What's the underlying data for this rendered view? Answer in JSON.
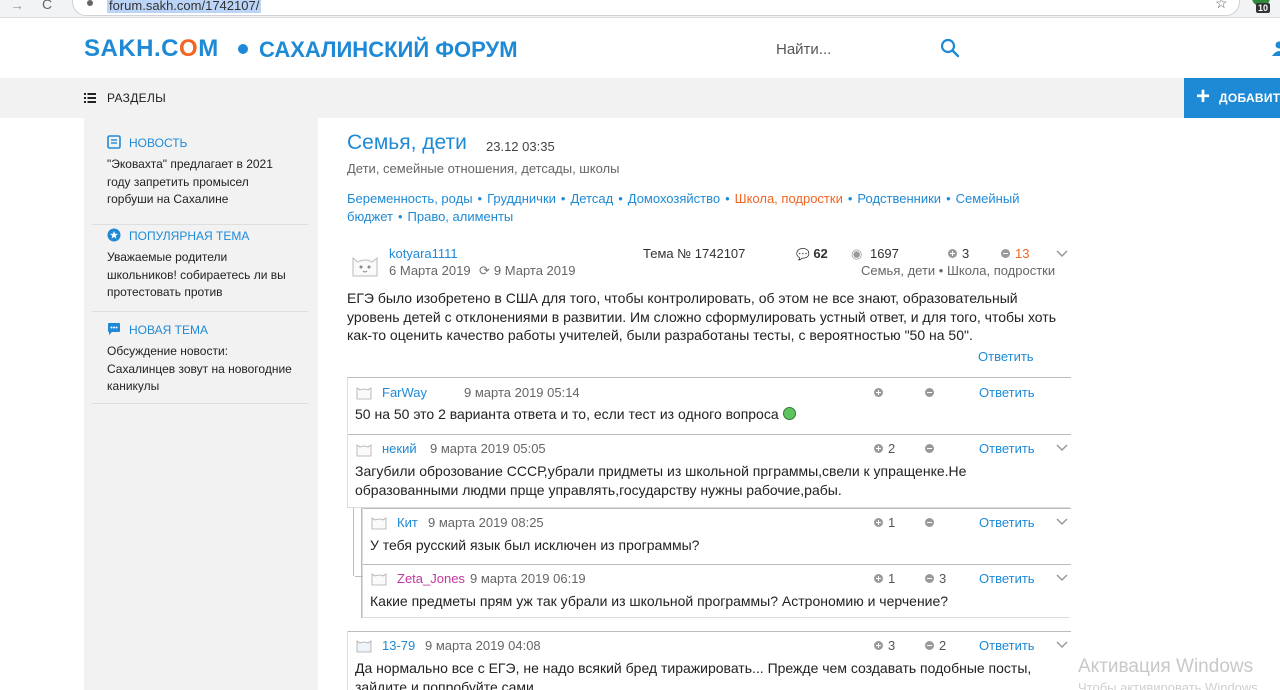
{
  "browser": {
    "url": "forum.sakh.com/1742107/",
    "extension_badge": "10"
  },
  "header": {
    "logo_prefix": "SAKH.C",
    "logo_o": "O",
    "logo_suffix": "M",
    "site_title": "САХАЛИНСКИЙ ФОРУМ",
    "search_placeholder": "Найти..."
  },
  "subbar": {
    "sections_label": "РАЗДЕЛЫ",
    "add_label": "ДОБАВИТЬ"
  },
  "sidebar": {
    "news": {
      "title": "НОВОСТЬ",
      "text": "\"Эковахта\" предлагает в 2021 году запретить промысел горбуши на Сахалине"
    },
    "popular": {
      "title": "ПОПУЛЯРНАЯ ТЕМА",
      "text": "Уважаемые родители школьников! собираетесь ли вы протестовать против"
    },
    "new_topic": {
      "title": "НОВАЯ ТЕМА",
      "text": "Обсуждение новости: Сахалинцев зовут на новогодние каникулы"
    }
  },
  "forum": {
    "title": "Семья, дети",
    "time": "23.12 03:35",
    "description": "Дети, семейные отношения, детсады, школы",
    "subcategories": [
      "Беременность, роды",
      "Грудднички",
      "Детсад",
      "Домохозяйство",
      "Школа, подростки",
      "Родственники",
      "Семейный бюджет",
      "Право, алименты"
    ],
    "active_subcategory": "Школа, подростки"
  },
  "topic": {
    "author": "kotyara1111",
    "date": "6 Марта 2019",
    "edited": "9 Марта 2019",
    "topic_number": "Тема № 1742107",
    "comments": "62",
    "views": "1697",
    "plus": "3",
    "minus": "13",
    "categories": "Семья, дети • Школа, подростки",
    "body": "ЕГЭ было изобретено в США для того, чтобы контролировать, об этом не все знают, образовательный уровень детей с отклонениями в развитии. Им сложно сформулировать устный ответ, и для того, чтобы хоть как-то оценить качество работы учителей, были разработаны тесты, с вероятностью \"50 на 50\".",
    "reply_label": "Ответить"
  },
  "comments": [
    {
      "author": "FarWay",
      "date": "9 марта 2019 05:14",
      "plus": "",
      "minus": "",
      "text": "50 на 50 это 2 варианта ответа и то, если тест из одного вопроса",
      "reply": "Ответить"
    },
    {
      "author": "некий",
      "date": "9 марта 2019 05:05",
      "plus": "2",
      "minus": "",
      "text": "Загубили оброзование СССР,убрали придметы из школьной прграммы,свели к упращенке.Не образованными людми прще управлять,государству нужны рабочие,рабы.",
      "reply": "Ответить"
    },
    {
      "author": "Кит",
      "date": "9 марта 2019 08:25",
      "plus": "1",
      "minus": "",
      "text": "У тебя русский язык был исключен из программы?",
      "reply": "Ответить"
    },
    {
      "author": "Zeta_Jones",
      "date": "9 марта 2019 06:19",
      "plus": "1",
      "minus": "3",
      "text": "Какие предметы прям уж так убрали из школьной программы? Астрономию и черчение?",
      "reply": "Ответить"
    },
    {
      "author": "13-79",
      "date": "9 марта 2019 04:08",
      "plus": "3",
      "minus": "2",
      "text": "Да нормально все с ЕГЭ, не надо всякий бред тиражировать... Прежде чем создавать подобные посты, зайдите и попробуйте сами",
      "reply": "Ответить"
    }
  ],
  "watermark": {
    "line1": "Активация Windows",
    "line2": "Чтобы активировать Windows"
  },
  "colors": {
    "accent": "#1e8ad6",
    "orange": "#f26522",
    "sidebar_bg": "#f2f2f2"
  }
}
